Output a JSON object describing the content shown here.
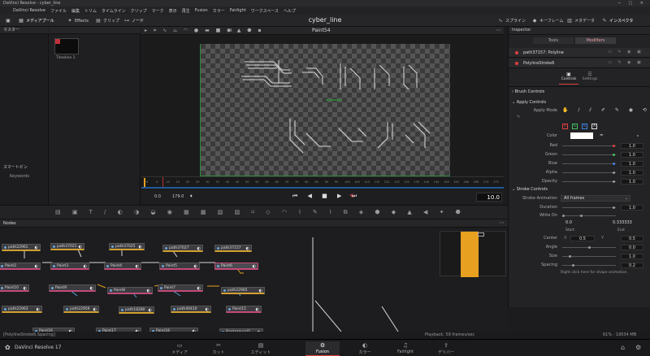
{
  "window": {
    "title": "DaVinci Resolve - cyber_line"
  },
  "menu": [
    "DaVinci Resolve",
    "ファイル",
    "編集",
    "トリム",
    "タイムライン",
    "クリップ",
    "マーク",
    "表示",
    "再生",
    "Fusion",
    "カラー",
    "Fairlight",
    "ワークスペース",
    "ヘルプ"
  ],
  "toolbar": {
    "media_pool": "メディアプール",
    "effects": "Effects",
    "clips": "クリップ",
    "nodes": "ノード",
    "project_title": "cyber_line",
    "spline": "スプライン",
    "keyframes": "キーフレーム",
    "metadata": "メタデータ",
    "inspector": "インスペクタ"
  },
  "media_pool": {
    "header": "マスター",
    "clip_name": "Timeline 1",
    "smart_bins": "スマートビン",
    "keywords": "Keywords"
  },
  "viewer": {
    "zoom": "Fit",
    "title": "Paint54",
    "start_frame": "0.0",
    "end_frame": "179.0",
    "current_frame": "10.0",
    "ruler_ticks": [
      "0",
      "5",
      "10",
      "15",
      "20",
      "25",
      "30",
      "35",
      "40",
      "45",
      "50",
      "55",
      "60",
      "65",
      "70",
      "75",
      "80",
      "85",
      "90",
      "95",
      "100",
      "105",
      "110",
      "115",
      "120",
      "125",
      "130",
      "135",
      "140",
      "145",
      "150",
      "155",
      "160",
      "165",
      "170",
      "175"
    ]
  },
  "inspector": {
    "title": "Inspector",
    "tab_tools": "Tools",
    "tab_modifiers": "Modifiers",
    "items": [
      {
        "name": "path37157: Polyline"
      },
      {
        "name": "PolylineStroke6"
      }
    ],
    "subtab_controls": "Controls",
    "subtab_settings": "Settings",
    "brush_controls": "Brush Controls",
    "apply_controls": "Apply Controls",
    "apply_mode": "Apply Mode",
    "channels": [
      "R",
      "G",
      "B",
      "A"
    ],
    "color_label": "Color",
    "red_label": "Red",
    "red_value": "1.0",
    "green_label": "Green",
    "green_value": "1.0",
    "blue_label": "Blue",
    "blue_value": "1.0",
    "alpha_label": "Alpha",
    "alpha_value": "1.0",
    "opacity_label": "Opacity",
    "opacity_value": "1.0",
    "stroke_controls": "Stroke Controls",
    "stroke_animation_label": "Stroke Animation",
    "stroke_animation_value": "All frames",
    "duration_label": "Duration",
    "duration_value": "1.0",
    "write_on_label": "Write On",
    "write_on_start": "0.0",
    "write_on_end": "0.333333",
    "start_label": "Start",
    "end_label": "End",
    "center_label": "Center",
    "center_x_label": "X",
    "center_x": "0.5",
    "center_y_label": "Y",
    "center_y": "0.5",
    "angle_label": "Angle",
    "angle_value": "0.0",
    "size_label": "Size",
    "size_value": "1.0",
    "spacing_label": "Spacing",
    "spacing_value": "0.2",
    "hint": "Right click here for shape animation"
  },
  "nodes": {
    "header": "Nodes",
    "items": [
      {
        "label": "path22961",
        "kind": "path"
      },
      {
        "label": "path37021",
        "kind": "path"
      },
      {
        "label": "path37025",
        "kind": "path"
      },
      {
        "label": "path37027",
        "kind": "path"
      },
      {
        "label": "path37157",
        "kind": "path"
      },
      {
        "label": "Paint2",
        "kind": "paint"
      },
      {
        "label": "Paint3",
        "kind": "paint"
      },
      {
        "label": "Paint4",
        "kind": "paint"
      },
      {
        "label": "Paint5",
        "kind": "paint"
      },
      {
        "label": "Paint6",
        "kind": "paint"
      },
      {
        "label": "Paint10",
        "kind": "paint"
      },
      {
        "label": "Paint9",
        "kind": "paint"
      },
      {
        "label": "Paint8",
        "kind": "paint"
      },
      {
        "label": "Paint7",
        "kind": "paint"
      },
      {
        "label": "path22965",
        "kind": "path"
      },
      {
        "label": "path22963",
        "kind": "path"
      },
      {
        "label": "path22959",
        "kind": "path"
      },
      {
        "label": "path18280",
        "kind": "path"
      },
      {
        "label": "path40410",
        "kind": "path"
      },
      {
        "label": "Paint15",
        "kind": "paint"
      },
      {
        "label": "Paint16",
        "kind": "paint"
      },
      {
        "label": "Paint17",
        "kind": "paint"
      },
      {
        "label": "Paint18",
        "kind": "paint"
      },
      {
        "label": "Background3",
        "kind": "bg"
      }
    ]
  },
  "status": {
    "left": "[PolylineStroke6.Spacing]",
    "playback": "Playback: 59 frames/sec",
    "memory": "61% · 19534 MB"
  },
  "pages": [
    {
      "label": "メディア",
      "icon": "▭"
    },
    {
      "label": "カット",
      "icon": "✂"
    },
    {
      "label": "エディット",
      "icon": "▤"
    },
    {
      "label": "Fusion",
      "icon": "⚙"
    },
    {
      "label": "カラー",
      "icon": "◐"
    },
    {
      "label": "Fairlight",
      "icon": "♫"
    },
    {
      "label": "デリバー",
      "icon": "⇪"
    }
  ],
  "app_name": "DaVinci Resolve 17",
  "colors": {
    "accent_red": "#e04040",
    "paint_node": "#c24a7a",
    "path_node": "#d0a030",
    "timeline_green": "#2e8b3a",
    "clip_orange": "#e8a020"
  }
}
